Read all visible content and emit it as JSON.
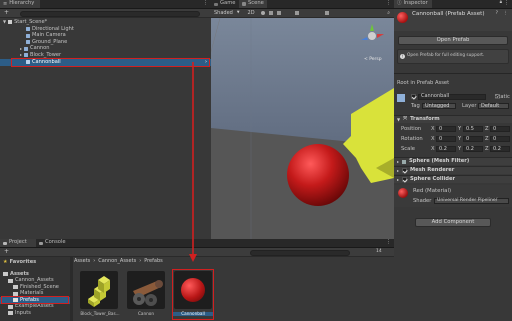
{
  "colors": {
    "accent_red": "#d12020",
    "selection": "#2c5d87",
    "sky": "#5a6b82",
    "ground": "#d9e23a",
    "ball": "#c41a1a"
  },
  "hierarchy": {
    "tab_label": "Hierarchy",
    "add_label": "+",
    "scene_name": "Start_Scene*",
    "items": [
      "Directional Light",
      "Main Camera",
      "Ground_Plane",
      "Cannon",
      "Block_Tower",
      "Cannonball"
    ]
  },
  "scene": {
    "tabs": [
      "Game",
      "Scene"
    ],
    "shading": "Shaded",
    "mode_2d": "2D",
    "persp_label": "< Persp"
  },
  "project": {
    "tabs": [
      "Project",
      "Console"
    ],
    "favorites_label": "Favorites",
    "breadcrumb": [
      "Assets",
      "Cannon_Assets",
      "Prefabs"
    ],
    "tree": [
      "Assets",
      "Cannon_Assets",
      "Finished_Scene",
      "Materials",
      "Prefabs",
      "ExampleAssets",
      "Inputs"
    ],
    "assets": [
      "Block_Tower_Bas...",
      "Cannon",
      "Cannonball"
    ],
    "count_label": "14"
  },
  "inspector": {
    "tab_label": "Inspector",
    "asset_title": "Cannonball (Prefab Asset)",
    "open_prefab_label": "Open Prefab",
    "info_text": "Open Prefab for full editing support.",
    "root_label": "Root in Prefab Asset",
    "object_name": "Cannonball",
    "static_label": "Static",
    "tag_label": "Tag",
    "tag_value": "Untagged",
    "layer_label": "Layer",
    "layer_value": "Default",
    "transform_label": "Transform",
    "position_label": "Position",
    "rotation_label": "Rotation",
    "scale_label": "Scale",
    "pos": {
      "x": "0",
      "y": "0.5",
      "z": "0"
    },
    "rot": {
      "x": "0",
      "y": "0",
      "z": "0"
    },
    "scl": {
      "x": "0.2",
      "y": "0.2",
      "z": "0.2"
    },
    "axis": {
      "x": "X",
      "y": "Y",
      "z": "Z"
    },
    "mesh_filter_label": "Sphere (Mesh Filter)",
    "mesh_renderer_label": "Mesh Renderer",
    "collider_label": "Sphere Collider",
    "material_label": "Red (Material)",
    "shader_label": "Shader",
    "shader_value": "Universal Render Pipeline/",
    "add_component_label": "Add Component"
  }
}
